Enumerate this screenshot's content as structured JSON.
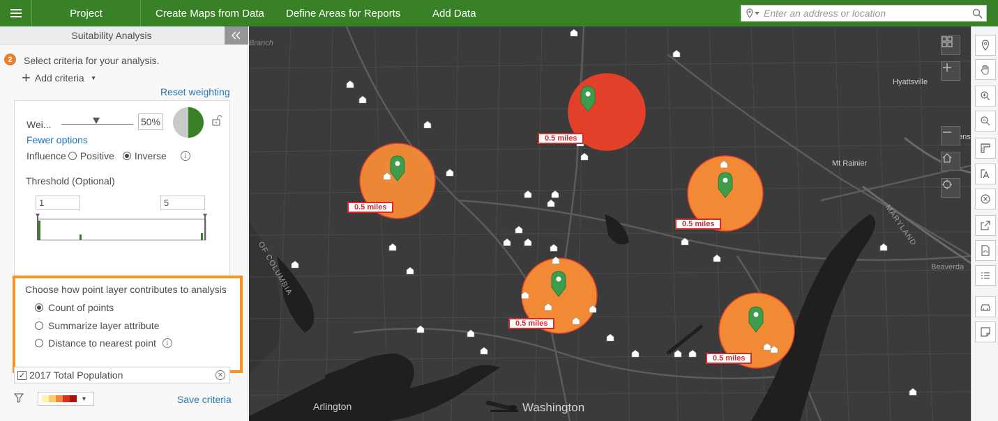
{
  "nav": {
    "project": "Project",
    "create_maps": "Create Maps from Data",
    "define_areas": "Define Areas for Reports",
    "add_data": "Add Data",
    "search_placeholder": "Enter an address or location"
  },
  "panel": {
    "title": "Suitability Analysis",
    "step_number": "2",
    "step_text": "Select criteria for your analysis.",
    "add_criteria": "Add criteria",
    "reset_weighting": "Reset weighting",
    "weight_label": "Wei...",
    "weight_value": "50%",
    "weight_fraction": 0.5,
    "fewer_options": "Fewer options",
    "influence_label": "Influence",
    "influence_positive": "Positive",
    "influence_inverse": "Inverse",
    "influence_selected": "Inverse",
    "threshold_label": "Threshold (Optional)",
    "threshold_min": "1",
    "threshold_max": "5",
    "contribution_title": "Choose how point layer contributes to analysis",
    "contribution_options": [
      "Count of points",
      "Summarize layer attribute",
      "Distance to nearest point"
    ],
    "contribution_selected": 0,
    "layer_name": "2017 Total Population",
    "layer_checked": true,
    "save_criteria": "Save criteria",
    "color_ramp": [
      "#fff3b0",
      "#fcc96b",
      "#f4873a",
      "#d7301f",
      "#b00f0f"
    ]
  },
  "map": {
    "distance_label": "0.5 miles",
    "place_labels": {
      "arlington": "Arlington",
      "washington": "Washington",
      "hyattsville": "Hyattsville",
      "mt_rainier": "Mt Rainier",
      "bladensburg": "Bladensbu",
      "maryland": "MARYLAND",
      "beaverdam": "Beaverda",
      "columbia": "OF COLUMBIA",
      "branch": "Branch"
    },
    "colors": {
      "high": "#e3402a",
      "mid": "#f28a35",
      "pin": "#3e9d4a"
    }
  }
}
